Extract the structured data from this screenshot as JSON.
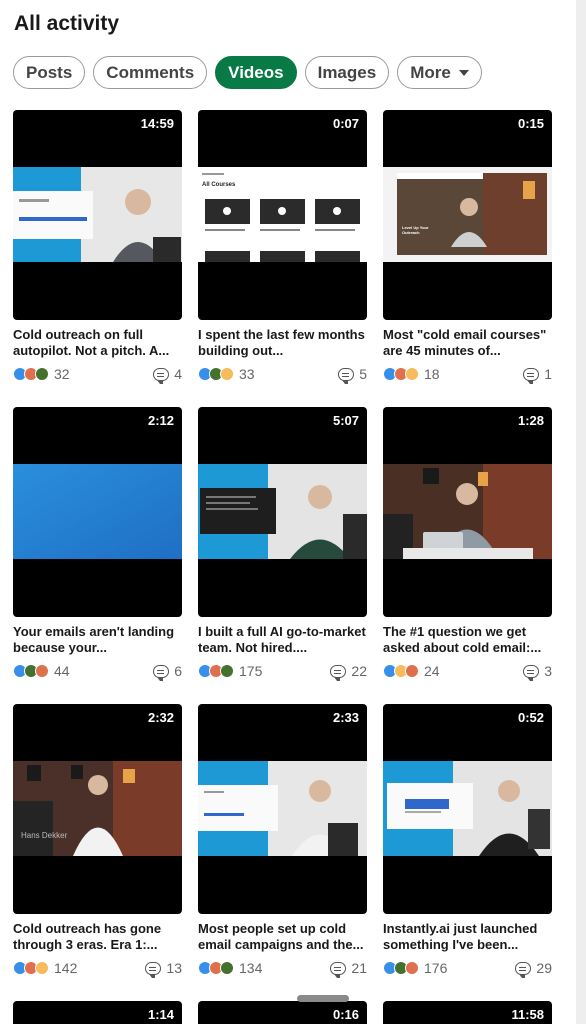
{
  "header": {
    "title": "All activity"
  },
  "filters": [
    {
      "label": "Posts",
      "active": false
    },
    {
      "label": "Comments",
      "active": false
    },
    {
      "label": "Videos",
      "active": true
    },
    {
      "label": "Images",
      "active": false
    },
    {
      "label": "More",
      "active": false
    }
  ],
  "videos": [
    {
      "duration": "14:59",
      "caption": "Cold outreach on full autopilot. Not a pitch. A...",
      "reactions": "32",
      "comments": "4"
    },
    {
      "duration": "0:07",
      "caption": "I spent the last few months building out...",
      "reactions": "33",
      "comments": "5"
    },
    {
      "duration": "0:15",
      "caption": "Most \"cold email courses\" are 45 minutes of...",
      "reactions": "18",
      "comments": "1"
    },
    {
      "duration": "2:12",
      "caption": "Your emails aren't landing because your...",
      "reactions": "44",
      "comments": "6"
    },
    {
      "duration": "5:07",
      "caption": "I built a full AI go-to-market team. Not hired....",
      "reactions": "175",
      "comments": "22"
    },
    {
      "duration": "1:28",
      "caption": "The #1 question we get asked about cold email:...",
      "reactions": "24",
      "comments": "3"
    },
    {
      "duration": "2:32",
      "caption": "Cold outreach has gone through 3 eras. Era 1:...",
      "reactions": "142",
      "comments": "13"
    },
    {
      "duration": "2:33",
      "caption": "Most people set up cold email campaigns and the...",
      "reactions": "134",
      "comments": "21"
    },
    {
      "duration": "0:52",
      "caption": "Instantly.ai just launched something I've been...",
      "reactions": "176",
      "comments": "29"
    }
  ],
  "partial_videos": [
    {
      "duration": "1:14"
    },
    {
      "duration": "0:16"
    },
    {
      "duration": "11:58"
    }
  ],
  "thumb_text": {
    "courses_title": "All Courses",
    "lead_up": "Level Up Your Outreach",
    "person_name": "Hans Dekker"
  },
  "colors": {
    "accent": "#087a45",
    "like": "#378fe9",
    "celebrate": "#44712e",
    "love": "#df704d",
    "insight": "#f5bb5c"
  }
}
